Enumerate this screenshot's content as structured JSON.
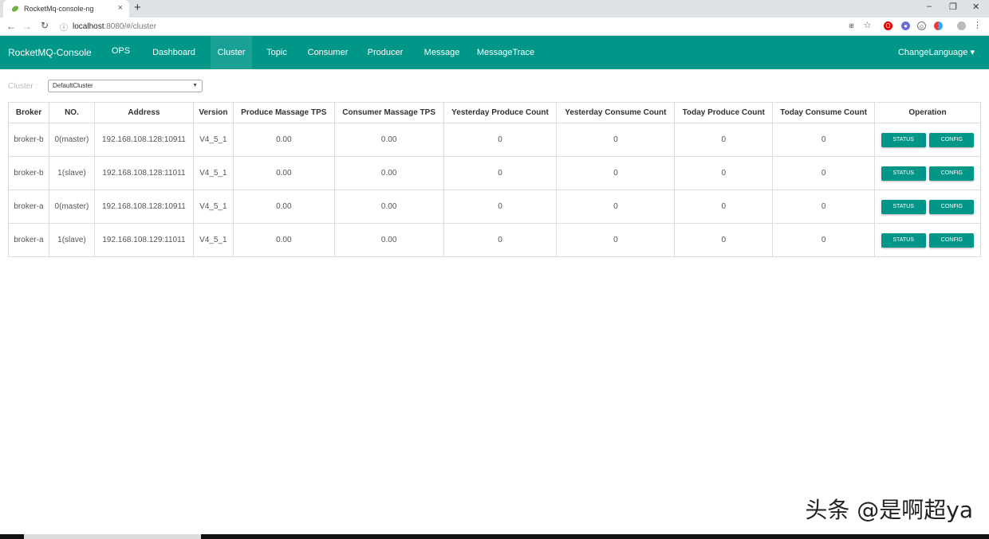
{
  "browser": {
    "tab_title": "RocketMq-console-ng",
    "tab_close": "×",
    "new_tab": "+",
    "url_host": "localhost",
    "url_path": ":8080/#/cluster",
    "minimize": "–",
    "restore": "❐",
    "close": "✕"
  },
  "navbar": {
    "brand": "RocketMQ-Console",
    "items": [
      {
        "label": "OPS"
      },
      {
        "label": "Dashboard"
      },
      {
        "label": "Cluster"
      },
      {
        "label": "Topic"
      },
      {
        "label": "Consumer"
      },
      {
        "label": "Producer"
      },
      {
        "label": "Message"
      },
      {
        "label": "MessageTrace"
      }
    ],
    "active": "Cluster",
    "language": "ChangeLanguage ▾"
  },
  "cluster": {
    "label": "Cluster :",
    "selected": "DefaultCluster"
  },
  "table": {
    "headers": [
      "Broker",
      "NO.",
      "Address",
      "Version",
      "Produce Massage TPS",
      "Consumer Massage TPS",
      "Yesterday Produce Count",
      "Yesterday Consume Count",
      "Today Produce Count",
      "Today Consume Count",
      "Operation"
    ],
    "rows": [
      {
        "broker": "broker-b",
        "no": "0(master)",
        "address": "192.168.108.128:10911",
        "version": "V4_5_1",
        "produce_tps": "0.00",
        "consume_tps": "0.00",
        "y_produce": "0",
        "y_consume": "0",
        "t_produce": "0",
        "t_consume": "0"
      },
      {
        "broker": "broker-b",
        "no": "1(slave)",
        "address": "192.168.108.128:11011",
        "version": "V4_5_1",
        "produce_tps": "0.00",
        "consume_tps": "0.00",
        "y_produce": "0",
        "y_consume": "0",
        "t_produce": "0",
        "t_consume": "0"
      },
      {
        "broker": "broker-a",
        "no": "0(master)",
        "address": "192.168.108.128:10911",
        "version": "V4_5_1",
        "produce_tps": "0.00",
        "consume_tps": "0.00",
        "y_produce": "0",
        "y_consume": "0",
        "t_produce": "0",
        "t_consume": "0"
      },
      {
        "broker": "broker-a",
        "no": "1(slave)",
        "address": "192.168.108.129:11011",
        "version": "V4_5_1",
        "produce_tps": "0.00",
        "consume_tps": "0.00",
        "y_produce": "0",
        "y_consume": "0",
        "t_produce": "0",
        "t_consume": "0"
      }
    ],
    "status_label": "STATUS",
    "config_label": "CONFIG"
  },
  "watermark": "头条 @是啊超ya",
  "colors": {
    "primary": "#009688",
    "active_nav": "#1aa095"
  }
}
